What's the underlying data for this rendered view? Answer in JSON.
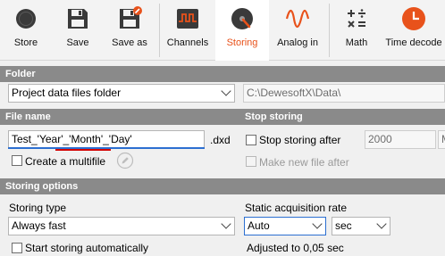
{
  "toolbar": {
    "store_label": "Store",
    "save_label": "Save",
    "save_as_label": "Save as",
    "channels_label": "Channels",
    "storing_label": "Storing",
    "analog_in_label": "Analog in",
    "math_label": "Math",
    "time_decode_label": "Time decode"
  },
  "folder": {
    "header": "Folder",
    "selected": "Project data files folder",
    "path": "C:\\DewesoftX\\Data\\"
  },
  "file_name": {
    "header": "File name",
    "value": "Test_'Year'_'Month'_'Day'",
    "extension": ".dxd",
    "create_multifile_label": "Create a multifile"
  },
  "stop_storing": {
    "header": "Stop storing",
    "stop_after_label": "Stop storing after",
    "stop_after_value": "2000",
    "unit_value": "M",
    "make_new_file_label": "Make new file after"
  },
  "storing_options": {
    "header": "Storing options",
    "storing_type_label": "Storing type",
    "storing_type_value": "Always fast",
    "start_automatically_label": "Start storing automatically",
    "static_rate_label": "Static acquisition rate",
    "static_rate_value": "Auto",
    "static_rate_unit": "sec",
    "adjusted_text": "Adjusted to 0,05 sec"
  },
  "colors": {
    "accent": "#e8521b",
    "header_bg": "#8a8a8a",
    "focus": "#2c6fd1",
    "spell_underline": "#d40000"
  }
}
